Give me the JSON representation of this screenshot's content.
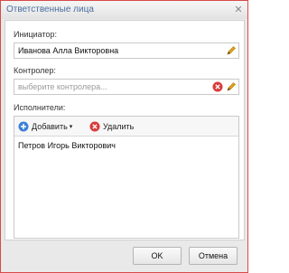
{
  "window": {
    "title": "Ответственные лица"
  },
  "initiator": {
    "label": "Инициатор:",
    "value": "Иванова Алла Викторовна"
  },
  "controller": {
    "label": "Контролер:",
    "placeholder": "выберите контролера..."
  },
  "executors": {
    "label": "Исполнители:",
    "add_label": "Добавить",
    "delete_label": "Удалить",
    "items": [
      "Петров Игорь Викторович"
    ]
  },
  "buttons": {
    "ok": "OK",
    "cancel": "Отмена"
  },
  "colors": {
    "accent": "#4a6fa0",
    "border_active": "#d94a4a",
    "delete_red": "#d93b3b",
    "add_blue": "#3d7fd8",
    "edit_orange": "#e0a21a"
  }
}
